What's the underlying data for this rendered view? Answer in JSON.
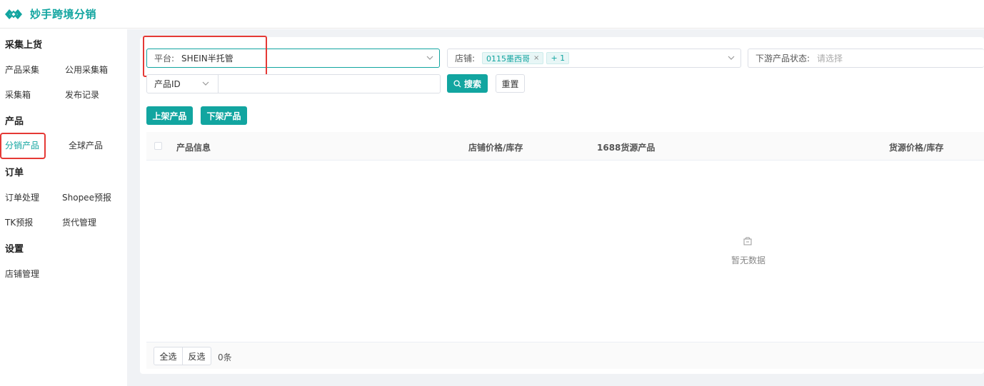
{
  "header": {
    "app_title": "妙手跨境分销",
    "logo_icon": "diamond-link-logo",
    "brand_color": "#12a5a0"
  },
  "sidebar": {
    "sections": [
      {
        "title": "采集上货",
        "items": [
          "产品采集",
          "公用采集箱",
          "采集箱",
          "发布记录"
        ]
      },
      {
        "title": "产品",
        "items": [
          "分销产品",
          "全球产品"
        ]
      },
      {
        "title": "订单",
        "items": [
          "订单处理",
          "Shopee预报",
          "TK预报",
          "货代管理"
        ]
      },
      {
        "title": "设置",
        "items": [
          "店铺管理"
        ]
      }
    ],
    "active_item": "分销产品"
  },
  "filters": {
    "platform": {
      "label": "平台:",
      "value": "SHEIN半托管"
    },
    "store": {
      "label": "店铺:",
      "tags": [
        "0115墨西哥"
      ],
      "more": "+ 1"
    },
    "downstream_status": {
      "label": "下游产品状态:",
      "placeholder": "请选择"
    },
    "id_type": {
      "value": "产品ID"
    },
    "id_input": {
      "value": ""
    },
    "search_label": "搜索",
    "reset_label": "重置"
  },
  "actions": {
    "list_label": "上架产品",
    "delist_label": "下架产品"
  },
  "table": {
    "columns": [
      "产品信息",
      "店铺价格/库存",
      "1688货源产品",
      "货源价格/库存"
    ],
    "empty_text": "暂无数据"
  },
  "footer": {
    "select_all": "全选",
    "invert": "反选",
    "count": "0条"
  },
  "colors": {
    "accent": "#12a5a0",
    "highlight_box": "#e53935",
    "bg": "#f0f2f5"
  }
}
